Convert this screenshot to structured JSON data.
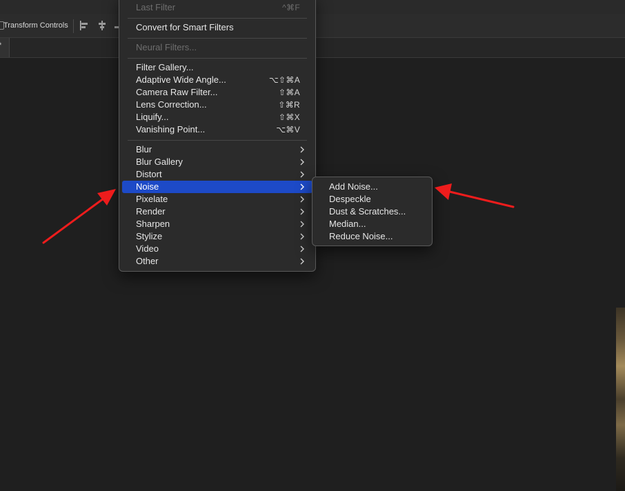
{
  "options_bar": {
    "transform_controls_label": "Transform Controls"
  },
  "tab": {
    "glyph": "*"
  },
  "filter_menu": {
    "last_filter": {
      "label": "Last Filter",
      "shortcut": "^⌘F"
    },
    "convert_smart": {
      "label": "Convert for Smart Filters"
    },
    "neural_filters": {
      "label": "Neural Filters..."
    },
    "group1": [
      {
        "label": "Filter Gallery...",
        "shortcut": ""
      },
      {
        "label": "Adaptive Wide Angle...",
        "shortcut": "⌥⇧⌘A"
      },
      {
        "label": "Camera Raw Filter...",
        "shortcut": "⇧⌘A"
      },
      {
        "label": "Lens Correction...",
        "shortcut": "⇧⌘R"
      },
      {
        "label": "Liquify...",
        "shortcut": "⇧⌘X"
      },
      {
        "label": "Vanishing Point...",
        "shortcut": "⌥⌘V"
      }
    ],
    "submenus": [
      {
        "label": "Blur"
      },
      {
        "label": "Blur Gallery"
      },
      {
        "label": "Distort"
      },
      {
        "label": "Noise",
        "selected": true
      },
      {
        "label": "Pixelate"
      },
      {
        "label": "Render"
      },
      {
        "label": "Sharpen"
      },
      {
        "label": "Stylize"
      },
      {
        "label": "Video"
      },
      {
        "label": "Other"
      }
    ]
  },
  "noise_submenu": {
    "items": [
      {
        "label": "Add Noise..."
      },
      {
        "label": "Despeckle"
      },
      {
        "label": "Dust & Scratches..."
      },
      {
        "label": "Median..."
      },
      {
        "label": "Reduce Noise..."
      }
    ]
  },
  "colors": {
    "selection": "#1d4ac7",
    "annotation_arrow": "#ee1c1c",
    "menu_bg": "#2b2b2b",
    "workspace_bg": "#1f1f1f"
  },
  "icons": [
    "chevron-right-icon",
    "align-left-icon",
    "align-center-icon",
    "checkbox-icon"
  ]
}
